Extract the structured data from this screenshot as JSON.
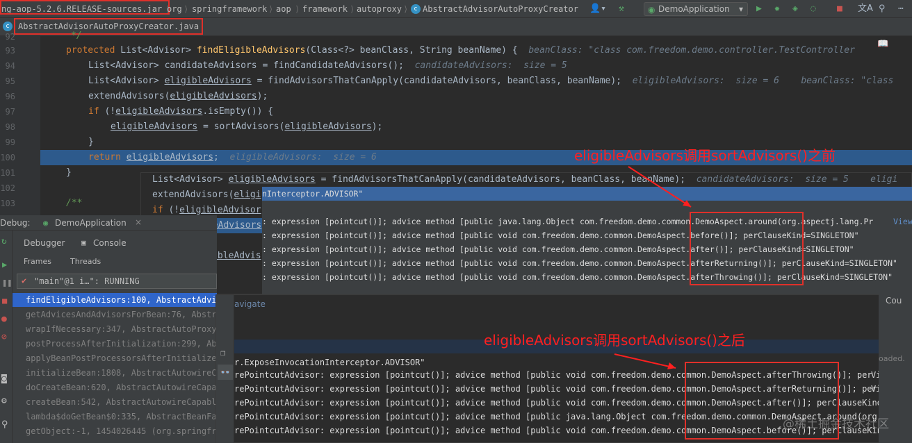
{
  "colors": {
    "annotation": "#ff2020",
    "keyword": "#cc7832",
    "method": "#ffc66d",
    "selection": "#2f65ca",
    "current_line": "#2d5a8c"
  },
  "navbar": {
    "source_jar": "ng-aop-5.2.6.RELEASE-sources.jar",
    "crumbs": [
      "org",
      "springframework",
      "aop",
      "framework",
      "autoproxy",
      "AbstractAdvisorAutoProxyCreator"
    ],
    "run_config": "DemoApplication",
    "icons": [
      "user-icon",
      "hammer-icon",
      "run-icon",
      "debug-icon",
      "stop-icon",
      "translate-icon",
      "search-icon"
    ]
  },
  "tab": {
    "label": "AbstractAdvisorAutoProxyCreator.java",
    "icon": "c"
  },
  "editor": {
    "line_numbers": [
      "92",
      "93",
      "94",
      "95",
      "96",
      "97",
      "98",
      "99",
      "100",
      "101",
      "102",
      "103"
    ],
    "lines": [
      {
        "code": "*/"
      },
      {
        "kw": "protected ",
        "plain": "List<Advisor> ",
        "fn": "findEligibleAdvisors",
        "rest": "(Class<?> beanClass, String beanName) {",
        "hint": "beanClass: \"class com.freedom.demo.controller.TestController"
      },
      {
        "code": "List<Advisor> candidateAdvisors = findCandidateAdvisors();",
        "hint": "candidateAdvisors:  size = 5"
      },
      {
        "code_a": "List<Advisor> ",
        "var": "eligibleAdvisors",
        "code_b": " = findAdvisorsThatCanApply(candidateAdvisors, beanClass, beanName);",
        "hint": "eligibleAdvisors:  size = 6    beanClass: \"class"
      },
      {
        "code_a": "extendAdvisors(",
        "var": "eligibleAdvisors",
        "code_b": ");"
      },
      {
        "kw": "if ",
        "code_a": "(!",
        "var": "eligibleAdvisors",
        "code_b": ".isEmpty()) {"
      },
      {
        "var": "eligibleAdvisors",
        "code_b": " = sortAdvisors(",
        "var2": "eligibleAdvisors",
        "code_c": ");"
      },
      {
        "code": "}"
      },
      {
        "kw": "return ",
        "var": "eligibleAdvisors",
        "code_b": ";",
        "hint": "eligibleAdvisors:  size = 6"
      },
      {
        "code": "}"
      },
      {
        "code": ""
      },
      {
        "comment": "/**"
      }
    ]
  },
  "annotations": {
    "before": "eligibleAdvisors调用sortAdvisors()之前",
    "after": "eligibleAdvisors调用sortAdvisors()之后"
  },
  "popup_before": {
    "code": [
      {
        "a": "List<Advisor> ",
        "var": "eligibleAdvisors",
        "b": " = findAdvisorsThatCanApply(candidateAdvisors, beanClass, beanName);",
        "hint": "candidateAdvisors:  size = 5    eligi"
      },
      {
        "a": "extendAdvisors(",
        "var": "eligi"
      },
      {
        "kw": "if ",
        "a": "(!",
        "var": "eligibleAdvisor"
      },
      {
        "var": "eligibleAdvisors"
      },
      {
        "a": "}"
      },
      {
        "kw": "return ",
        "var": "eligibleAdvis"
      }
    ],
    "header": "nInterceptor.ADVISOR\"",
    "rows": [
      ": expression [pointcut()]; advice method [public java.lang.Object com.freedom.demo.common.DemoAspect.around(org.aspectj.lang.Pr",
      ": expression [pointcut()]; advice method [public void com.freedom.demo.common.DemoAspect.before()]; perClauseKind=SINGLETON\"",
      ": expression [pointcut()]; advice method [public void com.freedom.demo.common.DemoAspect.after()]; perClauseKind=SINGLETON\"",
      ": expression [pointcut()]; advice method [public void com.freedom.demo.common.DemoAspect.afterReturning()]; perClauseKind=SINGLETON\"",
      ": expression [pointcut()]; advice method [public void com.freedom.demo.common.DemoAspect.afterThrowing()]; perClauseKind=SINGLETON\""
    ],
    "view_link": "View"
  },
  "debug": {
    "title": "Debug:",
    "app": "DemoApplication",
    "tabs": {
      "debugger": "Debugger",
      "console": "Console",
      "frames": "Frames",
      "threads": "Threads"
    },
    "thread": "\"main\"@1 i…\": RUNNING",
    "frames": [
      "findEligibleAdvisors:100, AbstractAdvis",
      "getAdvicesAndAdvisorsForBean:76, Abstra",
      "wrapIfNecessary:347, AbstractAutoProxyC",
      "postProcessAfterInitialization:299, Abs",
      "applyBeanPostProcessorsAfterInitialize",
      "initializeBean:1808, AbstractAutowireCa",
      "doCreateBean:620, AbstractAutowireCapab",
      "createBean:542, AbstractAutowireCapable",
      "lambda$doGetBean$0:335, AbstractBeanFac",
      "getObject:-1, 1454026445 (org.springfra"
    ]
  },
  "popup_after": {
    "navigate": "avigate",
    "header": "r.ExposeInvocationInterceptor.ADVISOR\"",
    "rows": [
      "rePointcutAdvisor: expression [pointcut()]; advice method [public void com.freedom.demo.common.DemoAspect.afterThrowing()]; per",
      "rePointcutAdvisor: expression [pointcut()]; advice method [public void com.freedom.demo.common.DemoAspect.afterReturning()]; per",
      "rePointcutAdvisor: expression [pointcut()]; advice method [public void com.freedom.demo.common.DemoAspect.after()]; perClauseKind=SIN",
      "rePointcutAdvisor: expression [pointcut()]; advice method [public java.lang.Object com.freedom.demo.common.DemoAspect.around(org",
      "rePointcutAdvisor: expression [pointcut()]; advice method [public void com.freedom.demo.common.DemoAspect.before()]; perClauseKind=SI"
    ],
    "view_link": "View",
    "side_label": "Cou",
    "side_label2": "oaded."
  },
  "watermark": "@稀土掘金技术社区"
}
